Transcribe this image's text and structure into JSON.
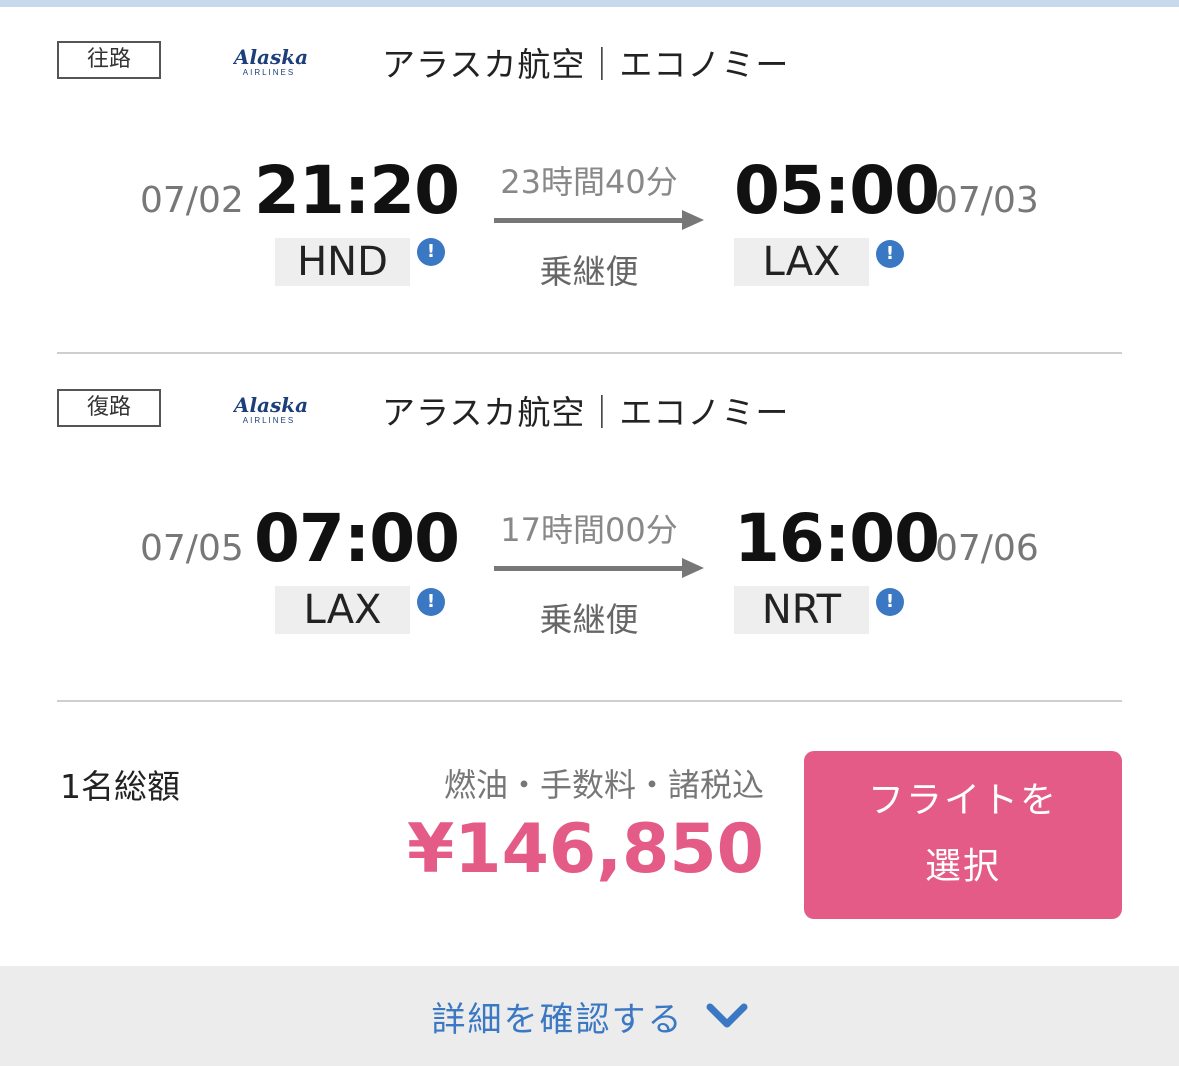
{
  "flights": [
    {
      "direction": "往路",
      "airline_logo": {
        "name": "Alaska",
        "sub": "AIRLINES"
      },
      "airline_class": "アラスカ航空｜エコノミー",
      "depart_date": "07/02",
      "depart_time": "21:20",
      "depart_airport": "HND",
      "duration": "23時間40分",
      "route_type": "乗継便",
      "arrive_time": "05:00",
      "arrive_date": "07/03",
      "arrive_airport": "LAX"
    },
    {
      "direction": "復路",
      "airline_logo": {
        "name": "Alaska",
        "sub": "AIRLINES"
      },
      "airline_class": "アラスカ航空｜エコノミー",
      "depart_date": "07/05",
      "depart_time": "07:00",
      "depart_airport": "LAX",
      "duration": "17時間00分",
      "route_type": "乗継便",
      "arrive_time": "16:00",
      "arrive_date": "07/06",
      "arrive_airport": "NRT"
    }
  ],
  "info_icon": "!",
  "price": {
    "label": "1名総額",
    "note": "燃油・手数料・諸税込",
    "amount": "¥146,850"
  },
  "select_button": {
    "line1": "フライトを",
    "line2": "選択"
  },
  "details": {
    "label": "詳細を確認する",
    "icon": "chevron-down-icon"
  },
  "colors": {
    "accent_pink": "#e35b86",
    "link_blue": "#3b78c3",
    "top_bar": "#c9d9ec",
    "footer_bg": "#ececec",
    "logo_navy": "#1c3f7a"
  }
}
